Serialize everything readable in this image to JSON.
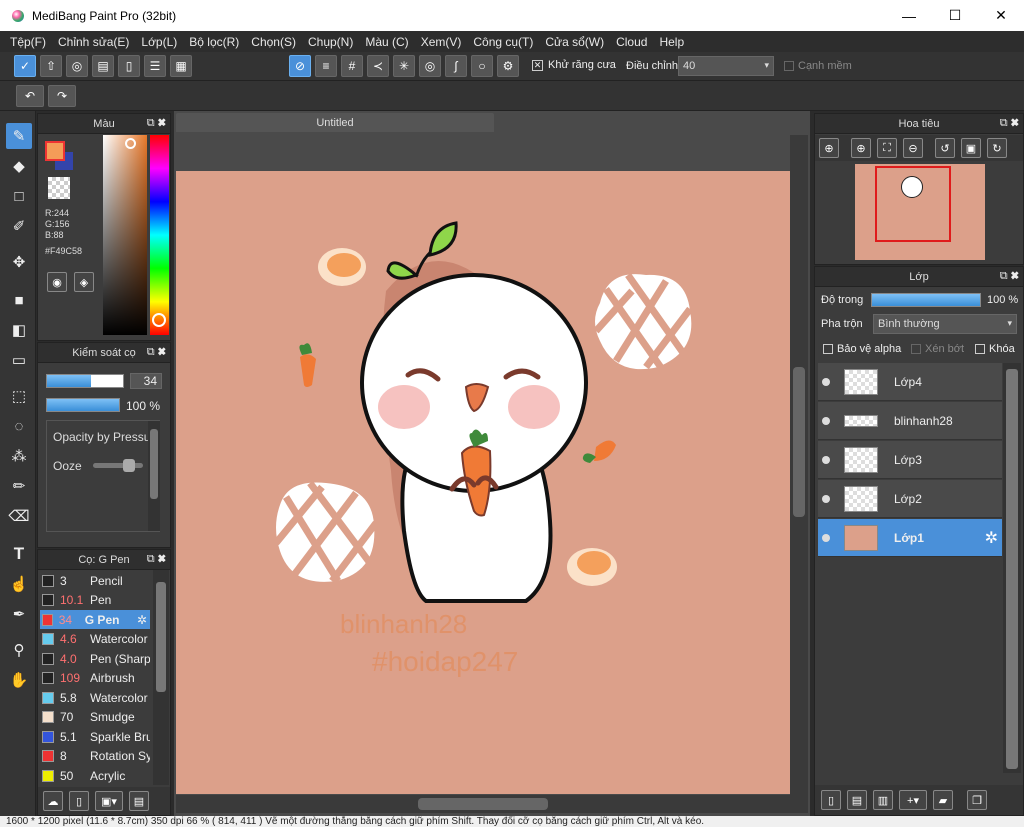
{
  "window": {
    "title": "MediBang Paint Pro (32bit)"
  },
  "menu": [
    "Tệp(F)",
    "Chỉnh sửa(E)",
    "Lớp(L)",
    "Bộ lọc(R)",
    "Chọn(S)",
    "Chụp(N)",
    "Màu (C)",
    "Xem(V)",
    "Công cụ(T)",
    "Cửa sổ(W)",
    "Cloud",
    "Help"
  ],
  "toolbar": {
    "antialias_label": "Khử răng cưa",
    "adjust_label": "Điều chỉnh",
    "adjust_value": "40",
    "soft_edge_label": "Cạnh mềm"
  },
  "doc_tab": "Untitled",
  "color_panel": {
    "title": "Màu",
    "r": "R:244",
    "g": "G:156",
    "b": "B:88",
    "hex": "#F49C58",
    "fg_color": "#F49C58",
    "bg_color": "#3344aa"
  },
  "brush_control": {
    "title": "Kiểm soát cọ",
    "size": "34",
    "opacity": "100 %",
    "pressure_label": "Opacity by Pressu",
    "ooze_label": "Ooze"
  },
  "brush_list": {
    "title": "Cọ: G Pen",
    "items": [
      {
        "size": "3",
        "name": "Pencil",
        "color": "#222222",
        "size_color": "#eeeeee"
      },
      {
        "size": "10.1",
        "name": "Pen",
        "color": "#222222",
        "size_color": "#ff7070"
      },
      {
        "size": "34",
        "name": "G Pen",
        "color": "#ee3333",
        "size_color": "#ff7070"
      },
      {
        "size": "4.6",
        "name": "Watercolor",
        "color": "#66ccee",
        "size_color": "#ff7070"
      },
      {
        "size": "4.0",
        "name": "Pen (Sharp)",
        "color": "#222222",
        "size_color": "#ff7070"
      },
      {
        "size": "109",
        "name": "Airbrush",
        "color": "#222222",
        "size_color": "#ff7070"
      },
      {
        "size": "5.8",
        "name": "Watercolor",
        "color": "#66ccee",
        "size_color": "#eeeeee"
      },
      {
        "size": "70",
        "name": "Smudge",
        "color": "#f5e0cc",
        "size_color": "#eeeeee"
      },
      {
        "size": "5.1",
        "name": "Sparkle Brush",
        "color": "#3355dd",
        "size_color": "#eeeeee"
      },
      {
        "size": "8",
        "name": "Rotation Sy",
        "color": "#ee3333",
        "size_color": "#eeeeee"
      },
      {
        "size": "50",
        "name": "Acrylic",
        "color": "#eeee00",
        "size_color": "#eeeeee"
      }
    ]
  },
  "navigator": {
    "title": "Hoa tiêu"
  },
  "layers": {
    "title": "Lớp",
    "opacity_label": "Độ trong",
    "opacity_value": "100 %",
    "opacity_level": 1.0,
    "blend_label": "Pha trộn",
    "blend_value": "Bình thường",
    "protect_alpha": "Bảo vệ alpha",
    "clipping": "Xén bớt",
    "lock": "Khóa",
    "items": [
      "Lớp4",
      "blinhanh28",
      "Lớp3",
      "Lớp2",
      "Lớp1"
    ]
  },
  "artwork": {
    "signature": "blinhanh28",
    "hashtag": "#hoidap247"
  },
  "statusbar": "1600 * 1200 pixel   (11.6 * 8.7cm)   350 dpi   66 %   ( 814, 411 )   Vẽ một đường thẳng bằng cách giữ phím Shift. Thay đổi cỡ cọ bằng cách giữ phím Ctrl, Alt và kéo."
}
